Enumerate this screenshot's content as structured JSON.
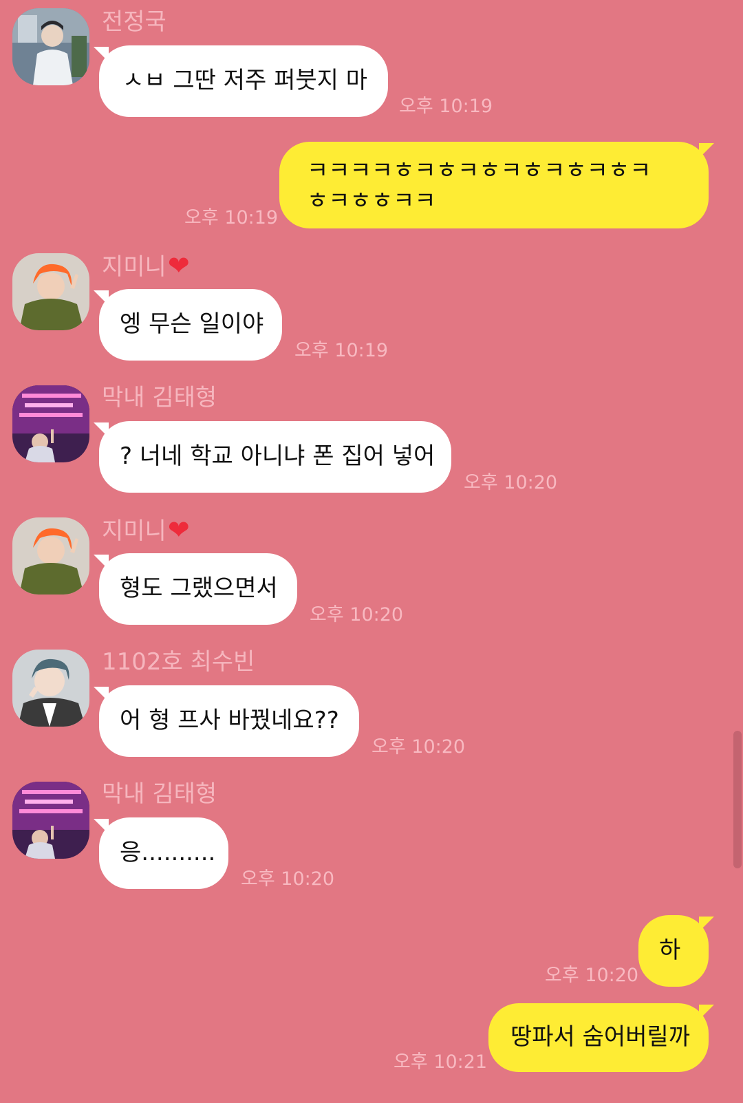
{
  "chat": {
    "messages": [
      {
        "sender": "전정국",
        "avatar": "jungkook-avatar",
        "text": "ㅅㅂ 그딴 저주 퍼붓지 마",
        "time": "오후 10:19",
        "direction": "incoming"
      },
      {
        "text_line1": "ㅋㅋㅋㅋㅎㅋㅎㅋㅎㅋㅎㅋㅎㅋㅎㅋ",
        "text_line2": "ㅎㅋㅎㅎㅋㅋ",
        "time": "오후 10:19",
        "direction": "outgoing"
      },
      {
        "sender": "지미니",
        "sender_icon": "heart-emoji",
        "avatar": "jimin-avatar",
        "text": "엥 무슨 일이야",
        "time": "오후 10:19",
        "direction": "incoming"
      },
      {
        "sender": "막내 김태형",
        "avatar": "taehyung-avatar",
        "text": "? 너네 학교 아니냐 폰 집어 넣어",
        "time": "오후 10:20",
        "direction": "incoming"
      },
      {
        "sender": "지미니",
        "sender_icon": "heart-emoji",
        "avatar": "jimin-avatar",
        "text": "형도 그랬으면서",
        "time": "오후 10:20",
        "direction": "incoming"
      },
      {
        "sender": "1102호 최수빈",
        "avatar": "soobin-avatar",
        "text": "어 형 프사 바꿨네요??",
        "time": "오후 10:20",
        "direction": "incoming"
      },
      {
        "sender": "막내 김태형",
        "avatar": "taehyung-avatar",
        "text": "응..........",
        "time": "오후 10:20",
        "direction": "incoming"
      },
      {
        "text": "하",
        "time": "오후 10:20",
        "direction": "outgoing"
      },
      {
        "text": "땅파서 숨어버릴까",
        "time": "오후 10:21",
        "direction": "outgoing"
      }
    ],
    "heart_symbol": "❤",
    "colors": {
      "background": "#e27783",
      "incoming_bubble": "#ffffff",
      "outgoing_bubble": "#feec34",
      "sender_name": "#f6b6be",
      "timestamp": "#f8b9c1"
    }
  }
}
